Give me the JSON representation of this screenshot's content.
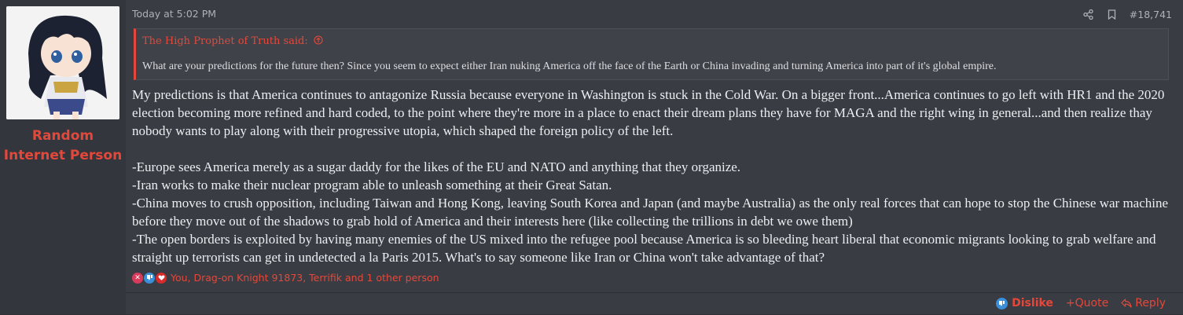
{
  "user": {
    "name_line1": "Random",
    "name_line2": "Internet Person"
  },
  "header": {
    "timestamp": "Today at 5:02 PM",
    "post_number": "#18,741",
    "icons": [
      "share-icon",
      "bookmark-icon"
    ]
  },
  "quote": {
    "attribution": "The High Prophet of Truth said:",
    "text": "What are your predictions for the future then? Since you seem to expect either Iran nuking America off the face of the Earth or China invading and turning America into part of it's global empire."
  },
  "body": {
    "paragraph1": "My predictions is that America continues to antagonize Russia because everyone in Washington is stuck in the Cold War. On a bigger front...America continues to go left with HR1 and the 2020 election becoming more refined and hard coded, to the point where they're more in a place to enact their dream plans they have for MAGA and the right wing in general...and then realize thay nobody wants to play along with their progressive utopia, which shaped the foreign policy of the left.",
    "item1": "-Europe sees America merely as a sugar daddy for the likes of the EU and NATO and anything that they organize.",
    "item2": "-Iran works to make their nuclear program able to unleash something at their Great Satan.",
    "item3": "-China moves to crush opposition, including Taiwan and Hong Kong, leaving South Korea and Japan (and maybe Australia) as the only real forces that can hope to stop the Chinese war machine before they move out of the shadows to grab hold of America and their interests here (like collecting the trillions in debt we owe them)",
    "item4": "-The open borders is exploited by having many enemies of the US mixed into the refugee pool because America is so bleeding heart liberal that economic migrants looking to grab welfare and straight up terrorists can get in undetected a la Paris 2015. What's to say someone like Iran or China won't take advantage of that?"
  },
  "reactions": {
    "names": "You, Drag-on Knight 91873, Terrifik and 1 other person",
    "icons": [
      "x-reaction-icon",
      "dislike-reaction-icon",
      "heart-reaction-icon"
    ]
  },
  "footer": {
    "dislike_label": "Dislike",
    "quote_label": "+Quote",
    "reply_label": "Reply"
  },
  "colors": {
    "accent": "#e5483a",
    "background": "#393c43",
    "sidebar": "#33363c"
  }
}
